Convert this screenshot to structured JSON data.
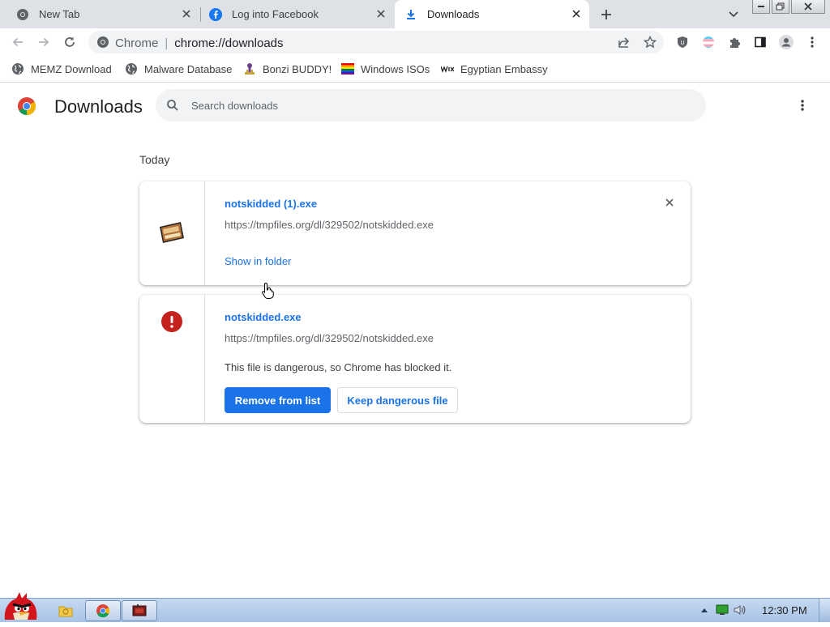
{
  "tabs": [
    {
      "title": "New Tab",
      "icon": "chrome-icon",
      "active": false
    },
    {
      "title": "Log into Facebook",
      "icon": "facebook-icon",
      "active": false
    },
    {
      "title": "Downloads",
      "icon": "download-icon",
      "active": true
    }
  ],
  "omnibox": {
    "site_label": "Chrome",
    "url": "chrome://downloads"
  },
  "bookmarks": [
    {
      "label": "MEMZ Download",
      "icon": "globe-icon"
    },
    {
      "label": "Malware Database",
      "icon": "globe-icon"
    },
    {
      "label": "Bonzi BUDDY!",
      "icon": "bonzi-icon"
    },
    {
      "label": "Windows ISOs",
      "icon": "rainbow-flag-icon"
    },
    {
      "label": "Egyptian Embassy",
      "icon": "wix-icon"
    }
  ],
  "downloads_page": {
    "title": "Downloads",
    "search_placeholder": "Search downloads",
    "date_header": "Today",
    "items": [
      {
        "file_name": "notskidded (1).exe",
        "url": "https://tmpfiles.org/dl/329502/notskidded.exe",
        "action_link": "Show in folder",
        "icon": "exe-file-icon"
      },
      {
        "file_name": "notskidded.exe",
        "url": "https://tmpfiles.org/dl/329502/notskidded.exe",
        "warning": "This file is dangerous, so Chrome has blocked it.",
        "primary_button": "Remove from list",
        "secondary_button": "Keep dangerous file",
        "icon": "danger-icon"
      }
    ]
  },
  "taskbar": {
    "clock": "12:30 PM"
  },
  "colors": {
    "accent": "#1a73e8",
    "danger": "#c5221f",
    "tabstrip": "#dee1e6"
  }
}
